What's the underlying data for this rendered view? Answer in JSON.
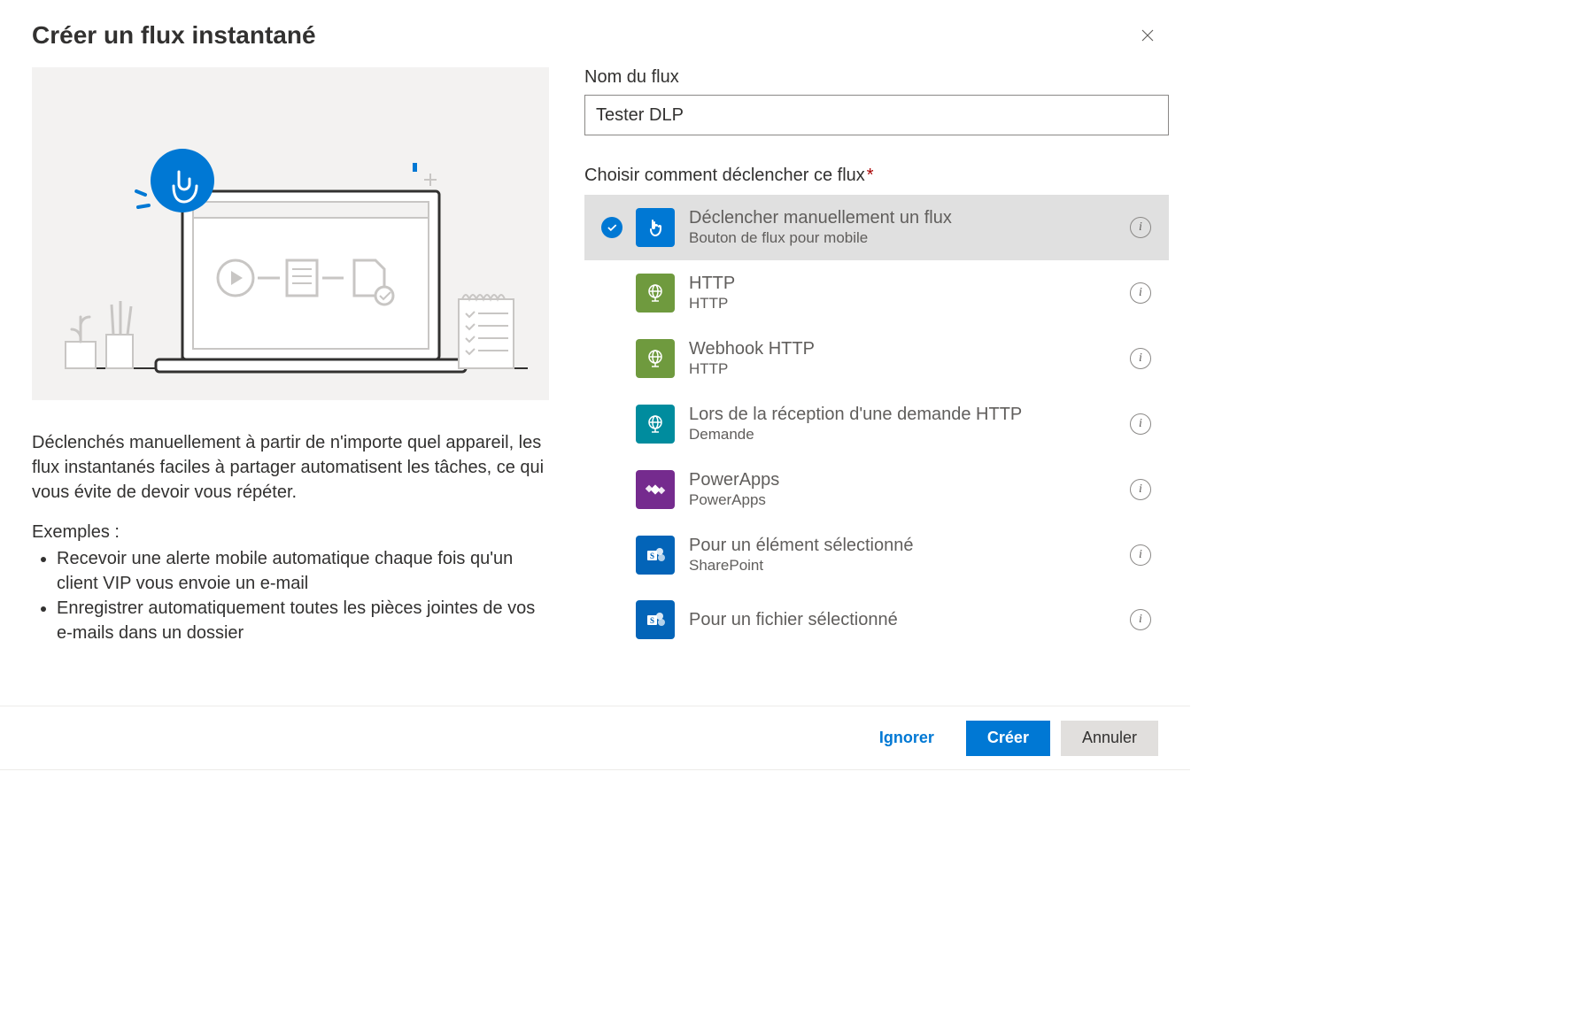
{
  "dialog": {
    "title": "Créer un flux instantané",
    "close_aria": "Fermer"
  },
  "left": {
    "description": "Déclenchés manuellement à partir de n'importe quel appareil, les flux instantanés faciles à partager automatisent les tâches, ce qui vous évite de devoir vous répéter.",
    "examples_label": "Exemples :",
    "examples": [
      "Recevoir une alerte mobile automatique chaque fois qu'un client VIP vous envoie un e-mail",
      "Enregistrer automatiquement toutes les pièces jointes de vos e-mails dans un dossier"
    ]
  },
  "right": {
    "name_label": "Nom du flux",
    "name_value": "Tester DLP",
    "trigger_label": "Choisir comment déclencher ce flux",
    "triggers": [
      {
        "title": "Déclencher manuellement un flux",
        "subtitle": "Bouton de flux pour mobile",
        "color": "ic-blue",
        "icon": "touch",
        "selected": true
      },
      {
        "title": "HTTP",
        "subtitle": "HTTP",
        "color": "ic-olive",
        "icon": "globe",
        "selected": false
      },
      {
        "title": "Webhook HTTP",
        "subtitle": "HTTP",
        "color": "ic-olive",
        "icon": "globe",
        "selected": false
      },
      {
        "title": "Lors de la réception d'une demande HTTP",
        "subtitle": "Demande",
        "color": "ic-teal",
        "icon": "globe",
        "selected": false
      },
      {
        "title": "PowerApps",
        "subtitle": "PowerApps",
        "color": "ic-purple",
        "icon": "diamond",
        "selected": false
      },
      {
        "title": "Pour un élément sélectionné",
        "subtitle": "SharePoint",
        "color": "ic-spdark",
        "icon": "sharepoint",
        "selected": false
      },
      {
        "title": "Pour un fichier sélectionné",
        "subtitle": "",
        "color": "ic-spdark",
        "icon": "sharepoint",
        "selected": false
      }
    ]
  },
  "footer": {
    "skip": "Ignorer",
    "create": "Créer",
    "cancel": "Annuler"
  }
}
